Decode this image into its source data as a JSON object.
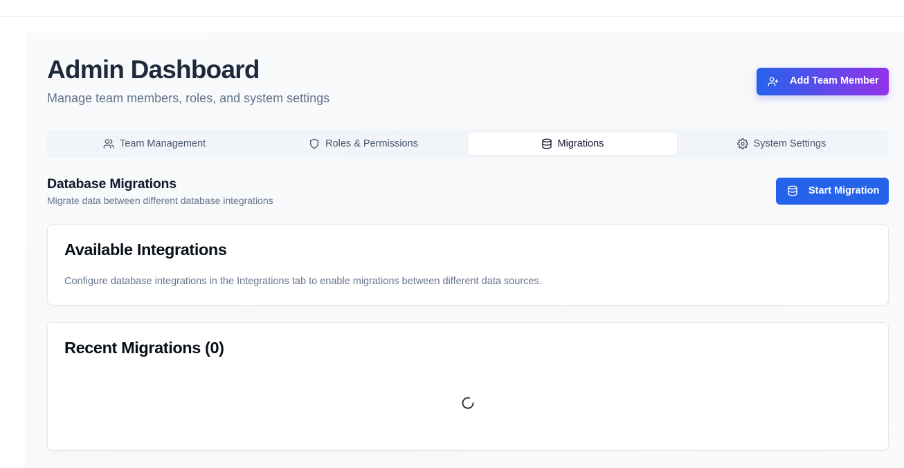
{
  "header": {
    "title": "Admin Dashboard",
    "subtitle": "Manage team members, roles, and system settings",
    "add_button_label": "Add Team Member"
  },
  "tabs": [
    {
      "label": "Team Management",
      "icon": "users-icon",
      "active": false
    },
    {
      "label": "Roles & Permissions",
      "icon": "shield-icon",
      "active": false
    },
    {
      "label": "Migrations",
      "icon": "database-icon",
      "active": true
    },
    {
      "label": "System Settings",
      "icon": "gear-icon",
      "active": false
    }
  ],
  "migrations": {
    "title": "Database Migrations",
    "subtitle": "Migrate data between different database integrations",
    "start_button_label": "Start Migration",
    "available": {
      "title": "Available Integrations",
      "text": "Configure database integrations in the Integrations tab to enable migrations between different data sources."
    },
    "recent": {
      "title": "Recent Migrations (0)",
      "loading_icon": "loading-spinner-icon"
    }
  },
  "colors": {
    "primary": "#2563eb",
    "gradient_end": "#9333ea",
    "muted_text": "#64748b",
    "heading": "#1e293b"
  }
}
